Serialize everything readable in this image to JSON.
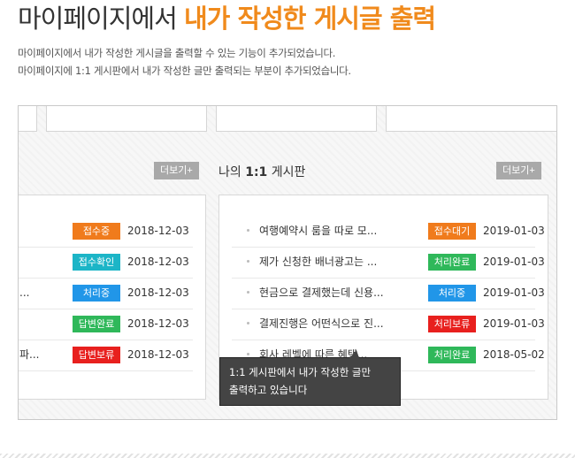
{
  "header": {
    "title_plain": "마이페이지에서",
    "title_highlight": "내가 작성한 게시글 출력",
    "desc_line1": "마이페이지에서 내가 작성한 게시글을 출력할 수 있는 기능이 추가되었습니다.",
    "desc_line2": "마이페이지에 1:1 게시판에서 내가 작성한 글만 출력되는 부분이 추가되었습니다."
  },
  "left_board": {
    "more_label": "더보기+",
    "rows": [
      {
        "subject": "",
        "status": "접수중",
        "status_color": "#f07b1c",
        "date": "2018-12-03"
      },
      {
        "subject": "",
        "status": "접수확인",
        "status_color": "#1cb5c7",
        "date": "2018-12-03"
      },
      {
        "subject": "...",
        "status": "처리중",
        "status_color": "#2196e8",
        "date": "2018-12-03"
      },
      {
        "subject": "",
        "status": "답변완료",
        "status_color": "#2fb85a",
        "date": "2018-12-03"
      },
      {
        "subject": "파...",
        "status": "답변보류",
        "status_color": "#e8201e",
        "date": "2018-12-03"
      }
    ]
  },
  "right_board": {
    "title_prefix": "나의",
    "title_bold": "1:1",
    "title_suffix": "게시판",
    "more_label": "더보기+",
    "rows": [
      {
        "subject": "여행예약시 룸을 따로 모...",
        "status": "접수대기",
        "status_color": "#f07b1c",
        "date": "2019-01-03"
      },
      {
        "subject": "제가 신청한 배너광고는 ...",
        "status": "처리완료",
        "status_color": "#2fb85a",
        "date": "2019-01-03"
      },
      {
        "subject": "현금으로 결제했는데 신용...",
        "status": "처리중",
        "status_color": "#2196e8",
        "date": "2019-01-03"
      },
      {
        "subject": "결제진행은 어떤식으로 진...",
        "status": "처리보류",
        "status_color": "#e8201e",
        "date": "2019-01-03"
      },
      {
        "subject": "회사 레벨에 따른 혜택...",
        "status": "처리완료",
        "status_color": "#2fb85a",
        "date": "2018-05-02"
      }
    ]
  },
  "tooltip": {
    "line1": "1:1 게시판에서 내가 작성한 글만",
    "line2": "출력하고 있습니다"
  }
}
